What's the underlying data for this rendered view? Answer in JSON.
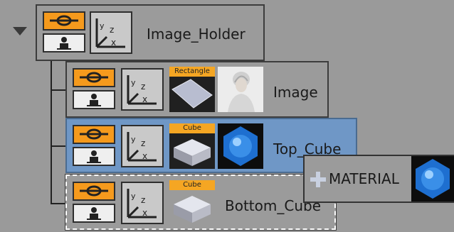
{
  "colors": {
    "background": "#9a9a9a",
    "selected_node": "#6f97c6",
    "toggle_accent": "#f59a1d",
    "tag_bg": "#f5a623"
  },
  "tree": {
    "root": {
      "label": "Image_Holder",
      "icons": [
        "visibility-toggle-icon",
        "person-icon",
        "axis-transform-icon"
      ]
    },
    "children": [
      {
        "label": "Image",
        "geometry_tag": "Rectangle",
        "icons": [
          "visibility-toggle-icon",
          "person-icon",
          "axis-transform-icon",
          "rectangle-geometry-icon",
          "portrait-texture-icon"
        ]
      },
      {
        "label": "Top_Cube",
        "geometry_tag": "Cube",
        "selected": true,
        "icons": [
          "visibility-toggle-icon",
          "person-icon",
          "axis-transform-icon",
          "cube-geometry-icon",
          "material-sphere-icon"
        ]
      },
      {
        "label": "Bottom_Cube",
        "geometry_tag": "Cube",
        "icons": [
          "visibility-toggle-icon",
          "person-icon",
          "axis-transform-icon",
          "cube-geometry-icon"
        ]
      }
    ]
  },
  "drag_item": {
    "label": "MATERIAL",
    "icons": [
      "plus-icon",
      "material-sphere-icon"
    ]
  },
  "axis_letters": {
    "x": "x",
    "y": "y",
    "z": "z"
  }
}
